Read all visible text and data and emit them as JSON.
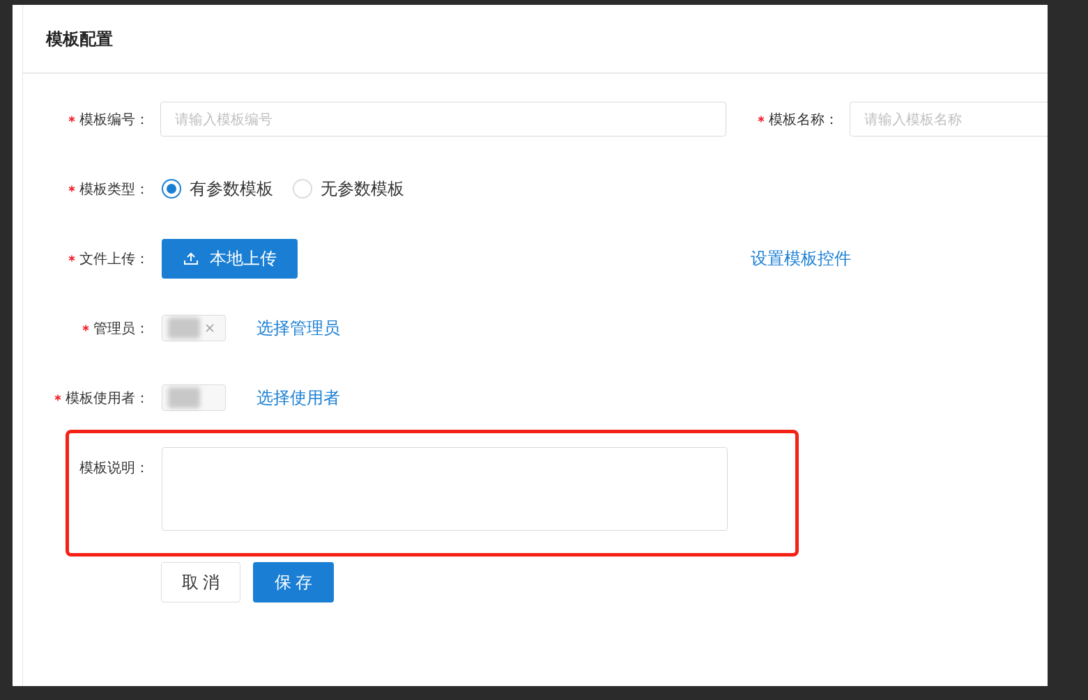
{
  "dialog": {
    "title": "模板配置"
  },
  "rows": [
    {
      "kind": "inputs",
      "fields": [
        {
          "label": "模板编号：",
          "required": true,
          "placeholder": "请输入模板编号"
        },
        {
          "label": "模板名称：",
          "required": true,
          "placeholder": "请输入模板名称"
        }
      ]
    },
    {
      "kind": "radio",
      "label": "模板类型：",
      "required": true,
      "options": [
        {
          "label": "有参数模板",
          "selected": true
        },
        {
          "label": "无参数模板",
          "selected": false
        }
      ]
    },
    {
      "kind": "upload",
      "label": "文件上传：",
      "required": true,
      "button": "本地上传",
      "link": "设置模板控件"
    },
    {
      "kind": "tags",
      "label": "管理员：",
      "required": true,
      "tags": [
        {
          "removable": true
        }
      ],
      "link": "选择管理员"
    },
    {
      "kind": "tags",
      "label": "模板使用者：",
      "required": true,
      "tags": [
        {
          "removable": false
        }
      ],
      "link": "选择使用者"
    },
    {
      "kind": "textarea",
      "label": "模板说明：",
      "required": false,
      "highlighted": true
    }
  ],
  "buttons": [
    {
      "label": "取 消",
      "kind": "default"
    },
    {
      "label": "保 存",
      "kind": "primary"
    }
  ]
}
